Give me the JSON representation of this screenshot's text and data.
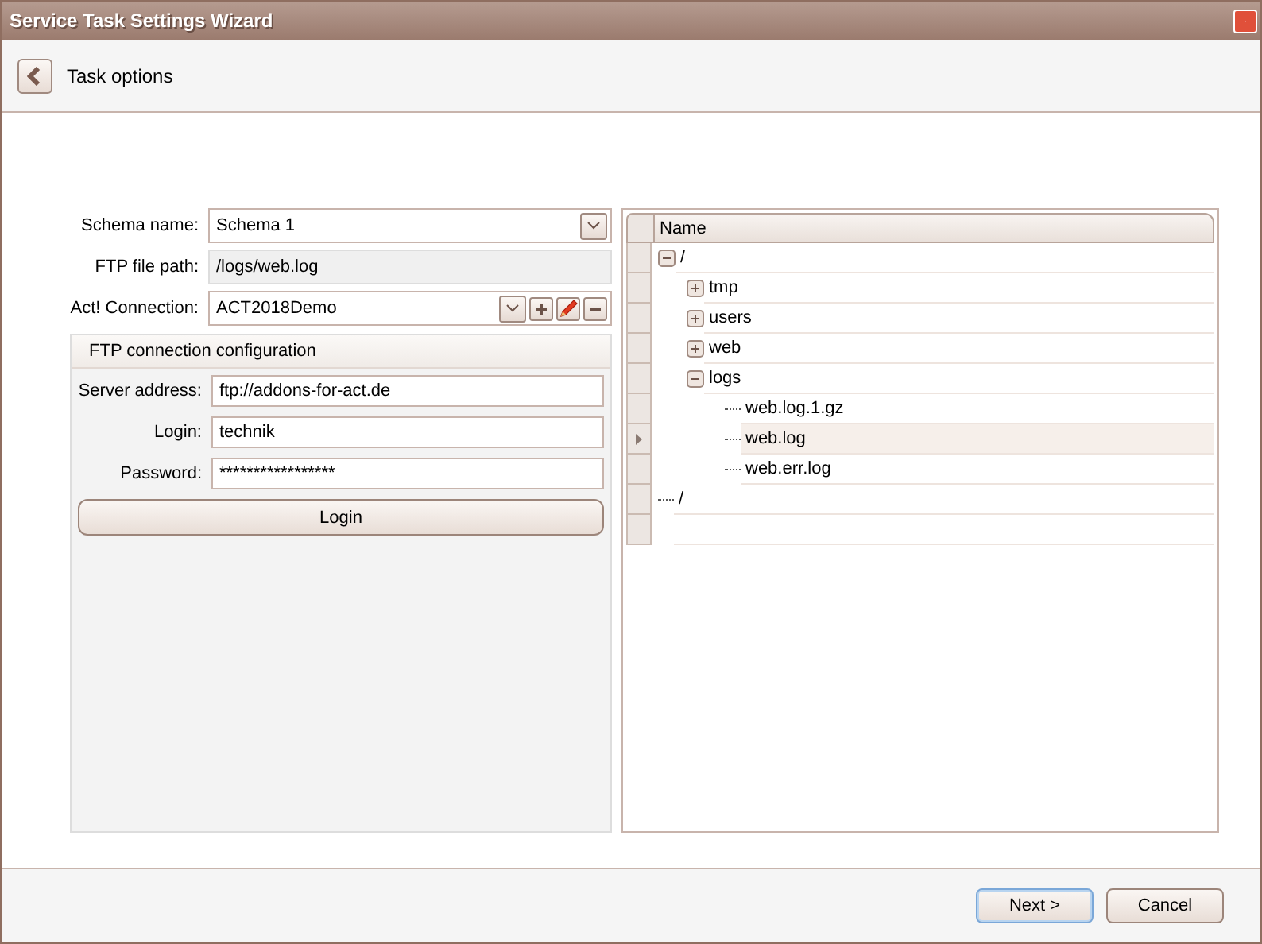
{
  "window": {
    "title": "Service Task Settings Wizard"
  },
  "header": {
    "title": "Task options"
  },
  "form": {
    "schema_name": {
      "label": "Schema name:",
      "value": "Schema 1"
    },
    "ftp_file_path": {
      "label": "FTP file path:",
      "value": "/logs/web.log"
    },
    "act_connection": {
      "label": "Act! Connection:",
      "value": "ACT2018Demo"
    }
  },
  "ftp_group": {
    "title": "FTP connection configuration",
    "fields": [
      {
        "label": "Server address:",
        "value": "ftp://addons-for-act.de"
      },
      {
        "label": "Login:",
        "value": "technik"
      },
      {
        "label": "Password:",
        "value": "*****************"
      }
    ],
    "login_button": "Login"
  },
  "tree": {
    "column": "Name",
    "nodes": [
      {
        "label": "/",
        "expanded": true,
        "selected": false,
        "children": [
          {
            "label": "tmp",
            "expanded": false,
            "selected": false
          },
          {
            "label": "users",
            "expanded": false,
            "selected": false
          },
          {
            "label": "web",
            "expanded": false,
            "selected": false
          },
          {
            "label": "logs",
            "expanded": true,
            "selected": false,
            "children": [
              {
                "label": "web.log.1.gz",
                "selected": false
              },
              {
                "label": "web.log",
                "selected": true
              },
              {
                "label": "web.err.log",
                "selected": false
              }
            ]
          }
        ]
      },
      {
        "label": "/",
        "selected": false
      }
    ]
  },
  "buttons": [
    {
      "label": "Next >",
      "default": true
    },
    {
      "label": "Cancel",
      "default": false
    }
  ]
}
